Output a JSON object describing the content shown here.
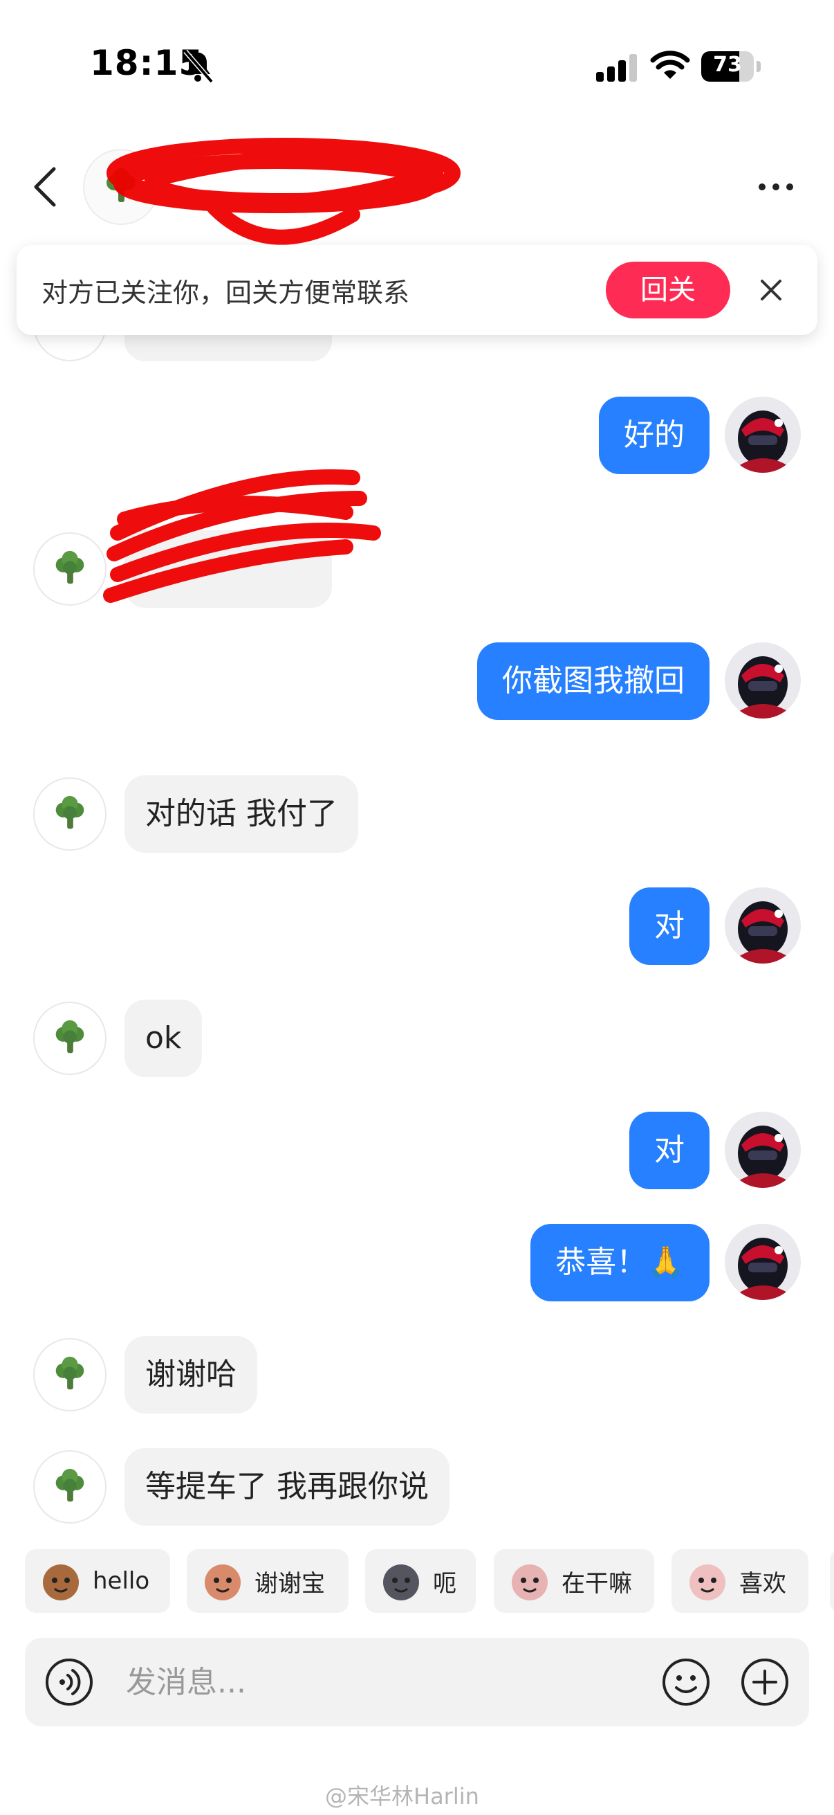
{
  "status_bar": {
    "time": "18:15",
    "battery": "73",
    "battery_level": 0.73
  },
  "header": {
    "name": "",
    "avatar_icon": "broccoli-icon",
    "more_icon": "more-icon"
  },
  "follow_banner": {
    "text": "对方已关注你，回关方便常联系",
    "button": "回关"
  },
  "messages": [
    {
      "side": "right",
      "text": "好的"
    },
    {
      "side": "left",
      "text": ""
    },
    {
      "side": "right",
      "text": "你截图我撤回"
    },
    {
      "side": "left",
      "text": "对的话 我付了"
    },
    {
      "side": "right",
      "text": "对"
    },
    {
      "side": "left",
      "text": "ok"
    },
    {
      "side": "right",
      "text": "对"
    },
    {
      "side": "right",
      "text": "恭喜！🙏"
    },
    {
      "side": "left",
      "text": "谢谢哈"
    },
    {
      "side": "left",
      "text": "等提车了 我再跟你说"
    }
  ],
  "quick_replies": [
    "hello",
    "谢谢宝",
    "呃",
    "在干嘛",
    "喜欢"
  ],
  "input": {
    "placeholder": "发消息..."
  },
  "watermark": "@宋华林Harlin",
  "colors": {
    "accent": "#fe2c55",
    "bubble_self": "#2680ff",
    "bubble_other": "#f2f2f2"
  }
}
